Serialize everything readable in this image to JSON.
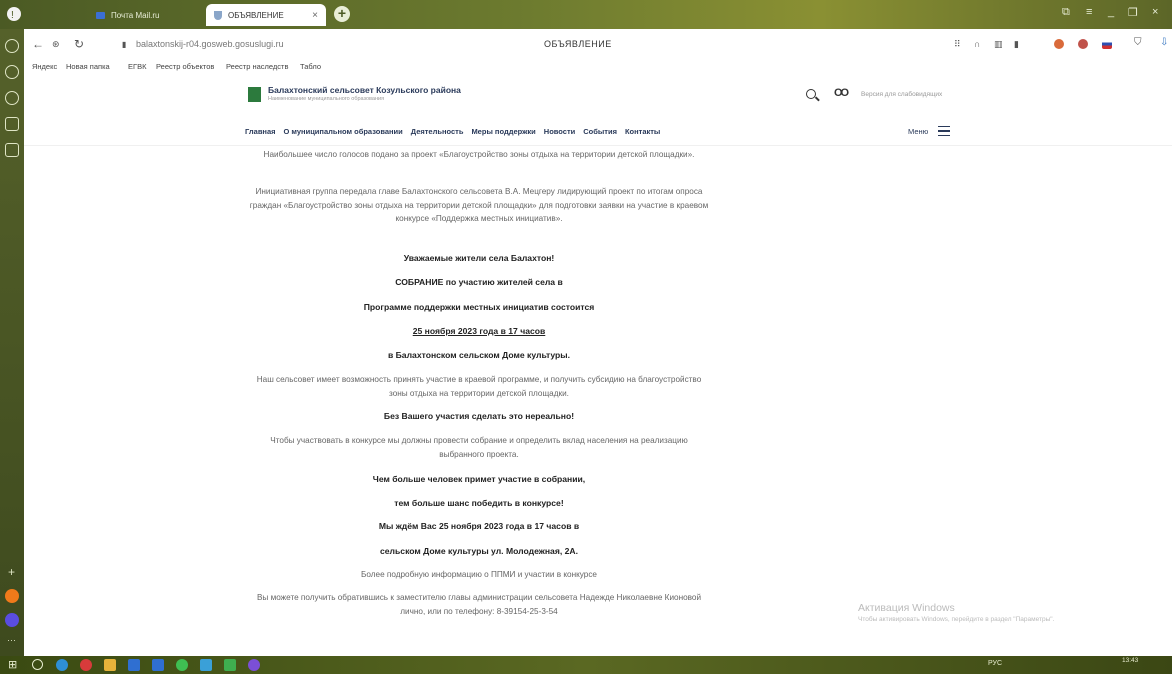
{
  "browser": {
    "tabs": [
      {
        "label": "Почта Mail.ru"
      },
      {
        "label": "ОБЪЯВЛЕНИЕ"
      }
    ],
    "address": "balaxtonskij-r04.gosweb.gosuslugi.ru",
    "page_title": "ОБЪЯВЛЕНИЕ",
    "bookmarks": [
      "Яндекс",
      "Новая папка",
      "ЕГВК",
      "Реестр объектов",
      "Реестр наследств",
      "Табло"
    ]
  },
  "site": {
    "title": "Балахтонский сельсовет Козульского района",
    "subtitle": "Наименование муниципального образования",
    "vision_label": "Версия для слабовидящих",
    "nav": [
      "Главная",
      "О муниципальном образовании",
      "Деятельность",
      "Меры поддержки",
      "Новости",
      "События",
      "Контакты"
    ],
    "menu_label": "Меню"
  },
  "content": {
    "p1": "Наибольшее число голосов подано за проект «Благоустройство зоны отдыха на территории детской площадки».",
    "p2": "Инициативная группа передала главе Балахтонского сельсовета В.А. Мецгеру лидирующий проект по итогам опроса граждан «Благоустройство зоны отдыха на территории детской площадки» для подготовки заявки на участие в краевом конкурсе «Поддержка местных инициатив».",
    "b1": "Уважаемые жители села Балахтон!",
    "b2": "СОБРАНИЕ по участию жителей села в",
    "b3": "Программе поддержки местных инициатив состоится",
    "b4": "25 ноября 2023 года в 17 часов",
    "b5": "в Балахтонском сельском Доме культуры.",
    "p3": "Наш сельсовет имеет возможность принять участие в краевой программе, и получить субсидию на благоустройство зоны отдыха на территории детской площадки.",
    "b6": "Без Вашего участия сделать это нереально!",
    "p4": "Чтобы участвовать в конкурсе мы должны провести собрание и определить вклад населения на реализацию выбранного проекта.",
    "b7": "Чем больше человек примет участие в собрании,",
    "b8": "тем больше шанс победить в конкурсе!",
    "b9": "Мы ждём Вас 25 ноября 2023 года в 17 часов в",
    "b10": "сельском Доме культуры ул. Молодежная, 2А.",
    "p5": "Более подробную информацию о ППМИ и участии в конкурсе",
    "p6": "Вы можете получить обратившись к заместителю главы администрации сельсовета Надежде Николаевне Кионовой лично, или по телефону: 8-39154-25-3-54"
  },
  "watermark": {
    "line1": "Активация Windows",
    "line2": "Чтобы активировать Windows, перейдите в раздел \"Параметры\"."
  },
  "taskbar": {
    "tray": "РУС",
    "time": "13:43"
  }
}
